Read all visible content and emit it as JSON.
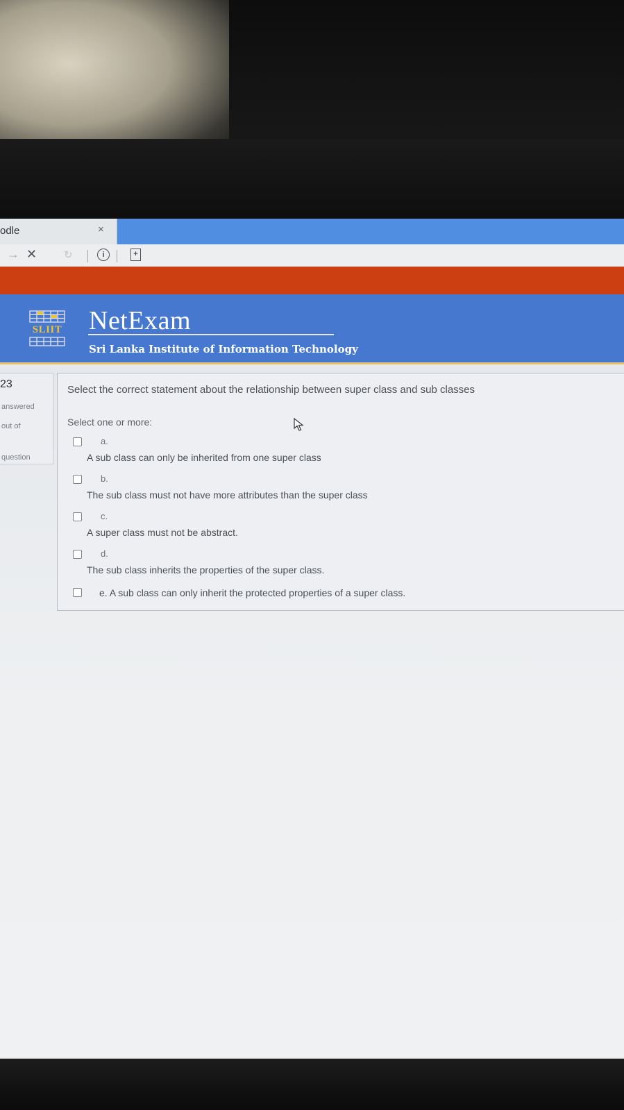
{
  "browser": {
    "tab_title": "odle",
    "tab_close": "×"
  },
  "toolbar": {
    "back_icon": "back-arrow-icon",
    "stop_icon": "close-icon",
    "reload_icon": "reload-icon",
    "info_icon": "info-icon",
    "page_icon": "page-icon"
  },
  "header": {
    "logo_text": "SLIIT",
    "title": "NetExam",
    "subtitle": "Sri Lanka Institute of Information Technology",
    "accent_orange": "#cc3f13",
    "accent_blue": "#4778d0",
    "logo_gold": "#f0c52b"
  },
  "question_info": {
    "number": "23",
    "status": "answered",
    "marks": "out of",
    "flag": "question"
  },
  "question": {
    "text": "Select the correct statement about the relationship between super class and sub classes",
    "prompt": "Select one or more:",
    "options": [
      {
        "letter": "a.",
        "text": "A sub class can only be inherited from one super class",
        "checked": false
      },
      {
        "letter": "b.",
        "text": "The sub class must not have more attributes than the super class",
        "checked": false
      },
      {
        "letter": "c.",
        "text": "A super class must not be abstract.",
        "checked": false
      },
      {
        "letter": "d.",
        "text": "The sub class inherits the properties of the super class.",
        "checked": false
      },
      {
        "letter": "",
        "text": "e. A sub class can only inherit the protected properties of a super class.",
        "checked": false
      }
    ]
  }
}
